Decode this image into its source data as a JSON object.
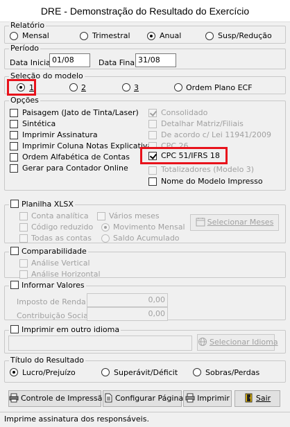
{
  "window": {
    "title": "DRE - Demonstração do Resultado do Exercício"
  },
  "relatorio": {
    "legend": "Relatório",
    "options": [
      "Mensal",
      "Trimestral",
      "Anual",
      "Susp/Redução"
    ],
    "selected": "Anual"
  },
  "periodo": {
    "legend": "Período",
    "inicial_label": "Data Inicial",
    "inicial_value": "01/08",
    "final_label": "Data Final",
    "final_value": "31/08"
  },
  "modelo": {
    "legend": "Seleção do modelo",
    "options": [
      "1",
      "2",
      "3",
      "Ordem Plano ECF"
    ],
    "selected": "1"
  },
  "opcoes": {
    "legend": "Opções",
    "left": [
      {
        "label": "Paisagem (Jato de Tinta/Laser)",
        "checked": false
      },
      {
        "label": "Sintética",
        "checked": false
      },
      {
        "label": "Imprimir Assinatura",
        "checked": false
      },
      {
        "label": "Imprimir Coluna Notas Explicativas",
        "checked": false
      },
      {
        "label": "Ordem Alfabética de Contas",
        "checked": false
      },
      {
        "label": "Gerar para Contador Online",
        "checked": false
      }
    ],
    "right": [
      {
        "label": "Consolidado",
        "checked": true,
        "disabled": true
      },
      {
        "label": "Detalhar Matriz/Filiais",
        "checked": false,
        "disabled": true
      },
      {
        "label": "De acordo c/ Lei 11941/2009",
        "checked": false,
        "disabled": true
      },
      {
        "label": "CPC 26",
        "checked": false,
        "disabled": true
      },
      {
        "label": "CPC 51/IFRS 18",
        "checked": true,
        "disabled": false
      },
      {
        "label": "Totalizadores (Modelo 3)",
        "checked": false,
        "disabled": true
      },
      {
        "label": "Nome do Modelo Impresso",
        "checked": false,
        "disabled": false
      }
    ]
  },
  "planilha": {
    "legend": "Planilha XLSX",
    "conta_analitica": "Conta analítica",
    "codigo_reduzido": "Código reduzido",
    "todas_contas": "Todas as contas",
    "varios_meses": "Vários meses",
    "movimento_mensal": "Movimento Mensal",
    "saldo_acumulado": "Saldo Acumulado",
    "selecionar_meses": "Selecionar Meses"
  },
  "comparabilidade": {
    "legend": "Comparabilidade",
    "vertical": "Análise Vertical",
    "horizontal": "Análise Horizontal"
  },
  "informar": {
    "legend": "Informar Valores",
    "imposto_label": "Imposto de Renda",
    "imposto_value": "0,00",
    "contribuicao_label": "Contribuição Social",
    "contribuicao_value": "0,00"
  },
  "idioma": {
    "legend": "Imprimir em outro idioma",
    "value": "",
    "button": "Selecionar Idioma"
  },
  "titulo": {
    "legend": "Título do Resultado",
    "options": [
      "Lucro/Prejuízo",
      "Superávit/Déficit",
      "Sobras/Perdas"
    ],
    "selected": "Lucro/Prejuízo"
  },
  "buttons": {
    "controle": "Controle de Impressão",
    "configurar": "Configurar Páginas",
    "imprimir": "Imprimir",
    "sair": "Sair"
  },
  "status": {
    "text": "Imprime assinatura dos responsáveis."
  },
  "colors": {
    "highlight": "#e8121b"
  }
}
